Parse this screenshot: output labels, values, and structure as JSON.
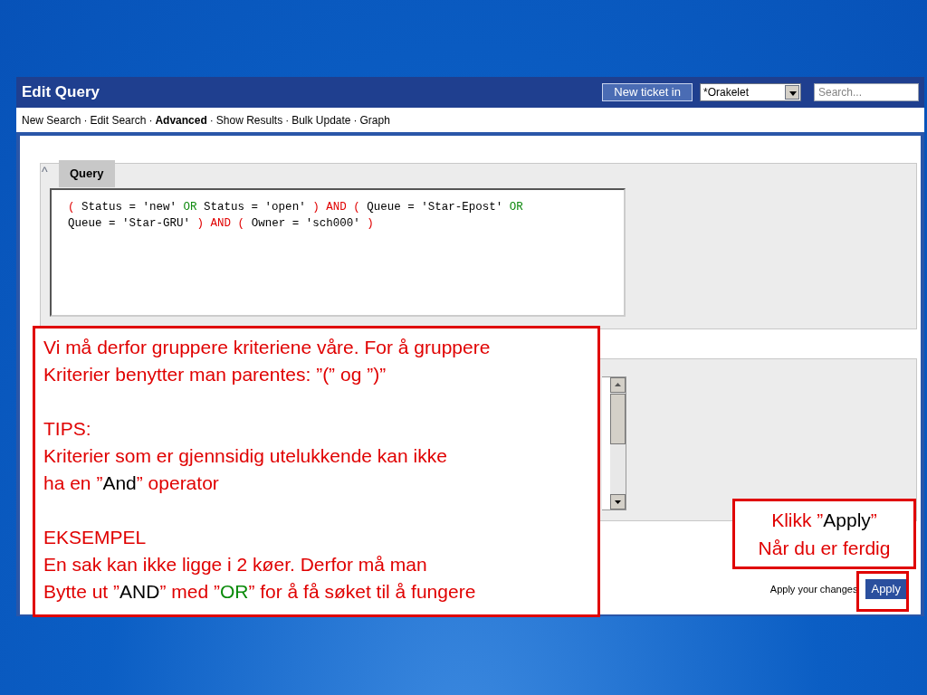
{
  "window": {
    "title": "Edit Query"
  },
  "header": {
    "new_ticket_button": "New ticket in",
    "queue_select": "*Orakelet",
    "search": {
      "placeholder": "Search..."
    }
  },
  "menu": {
    "separator": "·",
    "items": [
      {
        "label": "New Search",
        "selected": false
      },
      {
        "label": "Edit Search",
        "selected": false
      },
      {
        "label": "Advanced",
        "selected": true
      },
      {
        "label": "Show Results",
        "selected": false
      },
      {
        "label": "Bulk Update",
        "selected": false
      },
      {
        "label": "Graph",
        "selected": false
      }
    ]
  },
  "query_panel": {
    "collapse_toggle": "^",
    "tab": "Query",
    "lines": [
      [
        {
          "kind": "paren",
          "text": "("
        },
        {
          "kind": "text",
          "text": "Status = 'new'"
        },
        {
          "kind": "or",
          "text": "OR"
        },
        {
          "kind": "text",
          "text": "Status = 'open'"
        },
        {
          "kind": "paren",
          "text": ")"
        },
        {
          "kind": "and",
          "text": "AND"
        },
        {
          "kind": "paren",
          "text": "("
        },
        {
          "kind": "text",
          "text": "Queue = 'Star-Epost'"
        },
        {
          "kind": "or",
          "text": "OR"
        }
      ],
      [
        {
          "kind": "text",
          "text": "Queue = 'Star-GRU'"
        },
        {
          "kind": "paren",
          "text": ")"
        },
        {
          "kind": "and",
          "text": "AND"
        },
        {
          "kind": "paren",
          "text": "("
        },
        {
          "kind": "text",
          "text": "Owner = 'sch000'"
        },
        {
          "kind": "paren",
          "text": ")"
        }
      ]
    ]
  },
  "apply": {
    "label": "Apply your changes",
    "button": "Apply"
  },
  "callouts": [
    {
      "paragraphs": [
        [
          [
            {
              "kind": "plain",
              "text": "Vi må derfor gruppere kriteriene våre. For å gruppere"
            }
          ],
          [
            {
              "kind": "plain",
              "text": "Kriterier benytter man parentes: ”(” og ”)”"
            }
          ]
        ],
        [
          [
            {
              "kind": "plain",
              "text": "TIPS:"
            }
          ],
          [
            {
              "kind": "plain",
              "text": "Kriterier som er gjennsidig utelukkende kan ikke"
            }
          ],
          [
            {
              "kind": "plain",
              "text": "ha en ”"
            },
            {
              "kind": "term",
              "text": "And"
            },
            {
              "kind": "plain",
              "text": "” operator"
            }
          ]
        ],
        [
          [
            {
              "kind": "plain",
              "text": "EKSEMPEL"
            }
          ],
          [
            {
              "kind": "plain",
              "text": "En sak kan ikke ligge i 2 køer. Derfor må man"
            }
          ],
          [
            {
              "kind": "plain",
              "text": "Bytte ut ”"
            },
            {
              "kind": "term",
              "text": "AND"
            },
            {
              "kind": "plain",
              "text": "” med ”"
            },
            {
              "kind": "or",
              "text": "OR"
            },
            {
              "kind": "plain",
              "text": "” for å få søket til å fungere"
            }
          ]
        ]
      ]
    },
    {
      "paragraphs": [
        [
          [
            {
              "kind": "plain",
              "text": "Klikk ”"
            },
            {
              "kind": "term",
              "text": "Apply"
            },
            {
              "kind": "plain",
              "text": "”"
            }
          ],
          [
            {
              "kind": "plain",
              "text": "Når du er ferdig"
            }
          ]
        ]
      ]
    }
  ]
}
